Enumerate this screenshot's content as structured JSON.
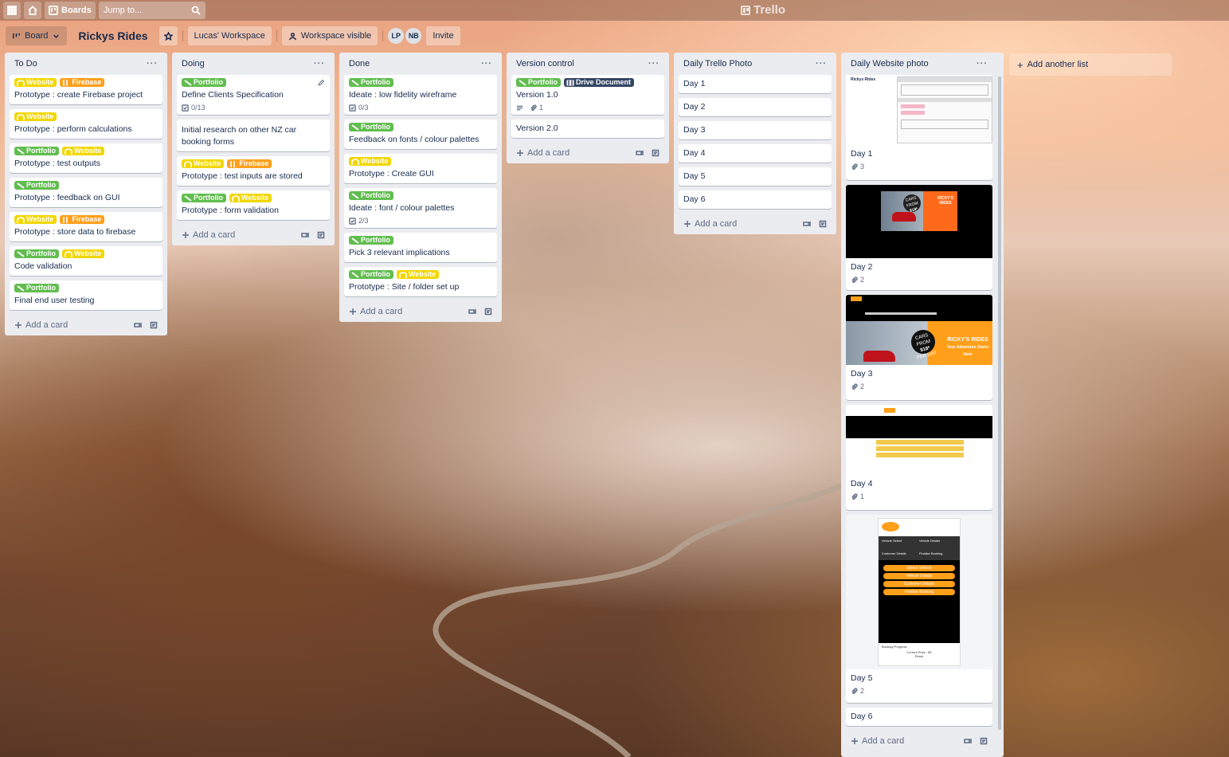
{
  "topbar": {
    "boards_label": "Boards",
    "search_placeholder": "Jump to...",
    "logo_text": "Trello"
  },
  "board": {
    "view_label": "Board",
    "title": "Rickys Rides",
    "workspace": "Lucas' Workspace",
    "visibility": "Workspace visible",
    "members": [
      "LP",
      "NB"
    ],
    "invite_label": "Invite"
  },
  "labels": {
    "website": "Website",
    "firebase": "Firebase",
    "portfolio": "Portfolio",
    "drive": "Drive Document"
  },
  "label_colors": {
    "green": "#61bd4f",
    "yellow": "#f2d600",
    "orange": "#ff9f1a",
    "navy": "#344563"
  },
  "add_card": "Add a card",
  "add_list": "Add another list",
  "lists": [
    {
      "title": "To Do",
      "cards": [
        {
          "title": "Prototype : create Firebase project"
        },
        {
          "title": "Prototype : perform calculations"
        },
        {
          "title": "Prototype : test outputs"
        },
        {
          "title": "Prototype : feedback on GUI"
        },
        {
          "title": "Prototype : store data to firebase"
        },
        {
          "title": "Code validation"
        },
        {
          "title": "Final end user testing"
        }
      ]
    },
    {
      "title": "Doing",
      "cards": [
        {
          "title": "Define Clients Specification",
          "checklist": "0/13"
        },
        {
          "title": "Initial research on other NZ car booking forms"
        },
        {
          "title": "Prototype : test inputs are stored"
        },
        {
          "title": "Prototype : form validation"
        }
      ]
    },
    {
      "title": "Done",
      "cards": [
        {
          "title": "Ideate : low fidelity wireframe",
          "checklist": "0/3"
        },
        {
          "title": "Feedback on fonts / colour palettes"
        },
        {
          "title": "Prototype : Create GUI"
        },
        {
          "title": "Ideate : font / colour palettes",
          "checklist": "2/3"
        },
        {
          "title": "Pick 3 relevant implications"
        },
        {
          "title": "Prototype : Site / folder set up"
        }
      ]
    },
    {
      "title": "Version control",
      "cards": [
        {
          "title": "Version 1.0",
          "attachments": "1"
        },
        {
          "title": "Version 2.0"
        }
      ]
    },
    {
      "title": "Daily Trello Photo",
      "cards": [
        {
          "title": "Day 1"
        },
        {
          "title": "Day 2"
        },
        {
          "title": "Day 3"
        },
        {
          "title": "Day 4"
        },
        {
          "title": "Day 5"
        },
        {
          "title": "Day 6"
        }
      ]
    },
    {
      "title": "Daily Website photo",
      "cards": [
        {
          "title": "Day 1",
          "attachments": "3"
        },
        {
          "title": "Day 2",
          "attachments": "2"
        },
        {
          "title": "Day 3",
          "attachments": "2"
        },
        {
          "title": "Day 4",
          "attachments": "1"
        },
        {
          "title": "Day 5",
          "attachments": "2"
        },
        {
          "title": "Day 6"
        }
      ]
    }
  ],
  "covers": {
    "day1_brand": "Rickys Rides",
    "rickys_rides_caps": "RICKY'S RIDES",
    "cars_from": "CARS FROM",
    "price": "$18*",
    "per_day": "PER DAY",
    "tagline": "Your Adventure Starts Here",
    "day5_steps": [
      "Vehicle Select",
      "Vehicle Details",
      "Customer Details",
      "Finalise Booking"
    ],
    "day5_buttons": [
      "Select Vehicle",
      "Vehicle Details",
      "Customer Details",
      "Finalise Booking"
    ],
    "day5_footer": "Booking Progress",
    "day5_price": "Current Price : $0",
    "day5_reset": "Reset"
  }
}
